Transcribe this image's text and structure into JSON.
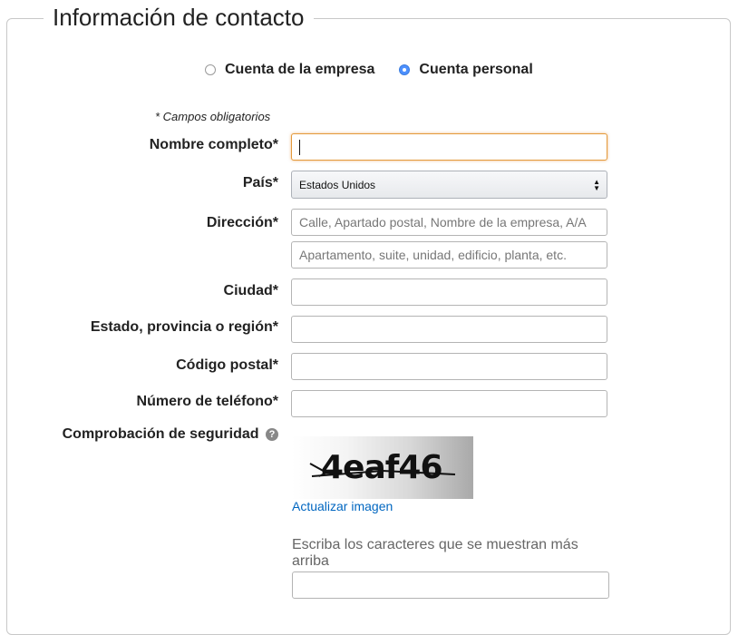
{
  "section": {
    "title": "Información de contacto"
  },
  "account_type": {
    "options": [
      {
        "label": "Cuenta de la empresa",
        "selected": false
      },
      {
        "label": "Cuenta personal",
        "selected": true
      }
    ]
  },
  "form": {
    "required_note": "* Campos obligatorios",
    "full_name": {
      "label": "Nombre completo*",
      "value": ""
    },
    "country": {
      "label": "País*",
      "selected": "Estados Unidos"
    },
    "address": {
      "label": "Dirección*",
      "line1_placeholder": "Calle, Apartado postal, Nombre de la empresa, A/A",
      "line2_placeholder": "Apartamento, suite, unidad, edificio, planta, etc."
    },
    "city": {
      "label": "Ciudad*",
      "value": ""
    },
    "state": {
      "label": "Estado, provincia o región*",
      "value": ""
    },
    "postal_code": {
      "label": "Código postal*",
      "value": ""
    },
    "phone": {
      "label": "Número de teléfono*",
      "value": ""
    },
    "security_check": {
      "label": "Comprobación de seguridad",
      "help_icon": "question-circle-icon",
      "captcha_text": "4eaf46",
      "refresh_link": "Actualizar imagen",
      "instructions": "Escriba los caracteres que se muestran más arriba",
      "value": ""
    }
  },
  "colors": {
    "radio_selected": "#4d90fe",
    "focus_border": "#e49a3c",
    "link": "#0066c0"
  }
}
